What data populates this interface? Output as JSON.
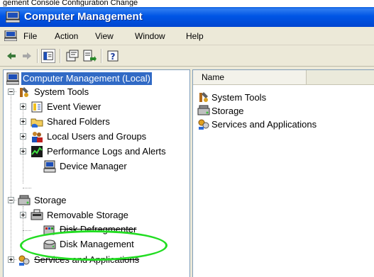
{
  "caption": "gement Console Configuration Change",
  "window": {
    "title": "Computer Management"
  },
  "menu": {
    "items": [
      "File",
      "Action",
      "View",
      "Window",
      "Help"
    ]
  },
  "tree": {
    "root": "Computer Management (Local)",
    "system_tools": "System Tools",
    "event_viewer": "Event Viewer",
    "shared_folders": "Shared Folders",
    "local_users": "Local Users and Groups",
    "perf_logs": "Performance Logs and Alerts",
    "device_manager": "Device Manager",
    "storage": "Storage",
    "removable_storage": "Removable Storage",
    "disk_defrag": "Disk Defragmenter",
    "disk_management": "Disk Management",
    "services_apps": "Services and Applications"
  },
  "list": {
    "column_name": "Name",
    "items": [
      "System Tools",
      "Storage",
      "Services and Applications"
    ]
  },
  "colors": {
    "highlight": "#22dd22",
    "selection": "#316ac5",
    "titlebar": "#0055e5"
  }
}
